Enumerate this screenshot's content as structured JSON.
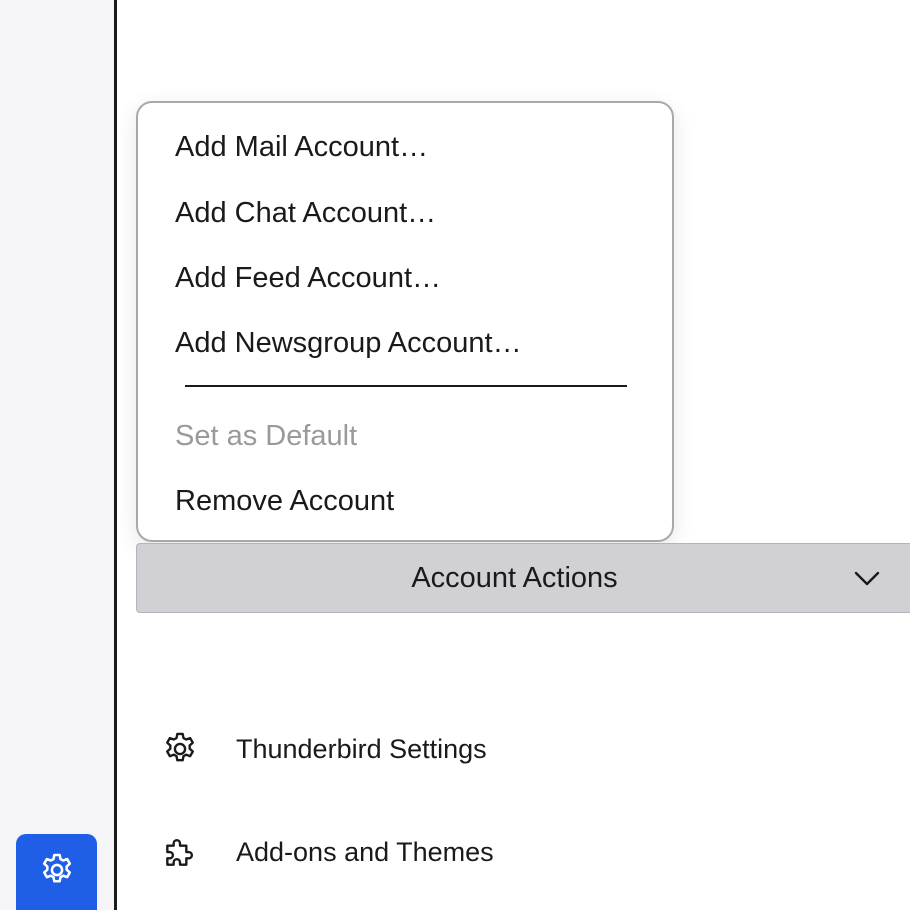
{
  "menu": {
    "items": [
      {
        "label": "Add Mail Account…",
        "enabled": true
      },
      {
        "label": "Add Chat Account…",
        "enabled": true
      },
      {
        "label": "Add Feed Account…",
        "enabled": true
      },
      {
        "label": "Add Newsgroup Account…",
        "enabled": true
      },
      {
        "label": "Set as Default",
        "enabled": false
      },
      {
        "label": "Remove Account",
        "enabled": true
      }
    ]
  },
  "account_actions": {
    "label": "Account Actions",
    "icon": "chevron-down-icon"
  },
  "footer": {
    "settings_label": "Thunderbird Settings",
    "settings_icon": "gear-icon",
    "addons_label": "Add-ons and Themes",
    "addons_icon": "puzzle-icon"
  },
  "spaces": {
    "settings_icon": "gear-icon",
    "accent_color": "#1f5ee6"
  }
}
